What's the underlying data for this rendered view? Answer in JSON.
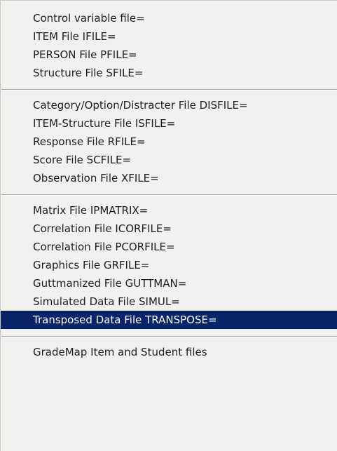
{
  "menu": {
    "groups": [
      {
        "items": [
          {
            "label": "Control variable file="
          },
          {
            "label": "ITEM File IFILE="
          },
          {
            "label": "PERSON File PFILE="
          },
          {
            "label": "Structure File SFILE="
          }
        ]
      },
      {
        "items": [
          {
            "label": "Category/Option/Distracter File DISFILE="
          },
          {
            "label": "ITEM-Structure File ISFILE="
          },
          {
            "label": "Response File RFILE="
          },
          {
            "label": "Score File SCFILE="
          },
          {
            "label": "Observation File XFILE="
          }
        ]
      },
      {
        "items": [
          {
            "label": "Matrix File IPMATRIX="
          },
          {
            "label": "Correlation File ICORFILE="
          },
          {
            "label": "Correlation File PCORFILE="
          },
          {
            "label": "Graphics File GRFILE="
          },
          {
            "label": "Guttmanized File GUTTMAN="
          },
          {
            "label": "Simulated Data File SIMUL="
          },
          {
            "label": "Transposed Data File TRANSPOSE=",
            "selected": true
          }
        ]
      },
      {
        "items": [
          {
            "label": "GradeMap Item and Student files"
          }
        ]
      }
    ],
    "colors": {
      "background": "#f1f1ef",
      "highlight": "#0a246a",
      "highlight_text": "#ffffff",
      "text": "#1e1e1e"
    }
  }
}
